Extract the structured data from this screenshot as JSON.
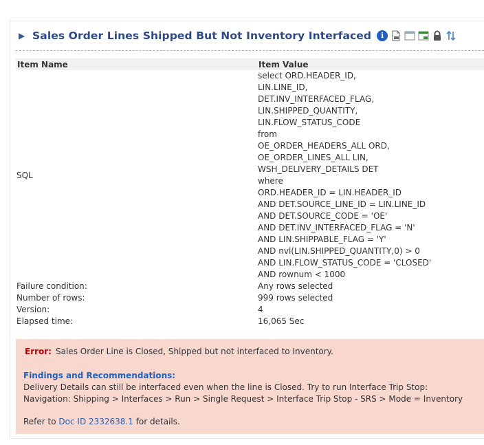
{
  "section": {
    "toggle": "▶",
    "title": "Sales Order Lines Shipped But Not Inventory Interfaced",
    "icons": [
      "info-icon",
      "sql-document-icon",
      "table-view-icon",
      "export-db-icon",
      "lock-icon",
      "sort-icon"
    ]
  },
  "table": {
    "headers": {
      "name": "Item Name",
      "value": "Item Value"
    },
    "sql_label": "SQL",
    "sql_lines": [
      "select ORD.HEADER_ID,",
      "LIN.LINE_ID,",
      "DET.INV_INTERFACED_FLAG,",
      "LIN.SHIPPED_QUANTITY,",
      "LIN.FLOW_STATUS_CODE",
      "from",
      "OE_ORDER_HEADERS_ALL ORD,",
      "OE_ORDER_LINES_ALL LIN,",
      "WSH_DELIVERY_DETAILS DET",
      "where",
      "ORD.HEADER_ID = LIN.HEADER_ID",
      "AND DET.SOURCE_LINE_ID = LIN.LINE_ID",
      "AND DET.SOURCE_CODE = 'OE'",
      "AND DET.INV_INTERFACED_FLAG = 'N'",
      "AND LIN.SHIPPABLE_FLAG = 'Y'",
      "AND nvl(LIN.SHIPPED_QUANTITY,0) > 0",
      "AND LIN.FLOW_STATUS_CODE = 'CLOSED'",
      "AND rownum < 1000"
    ],
    "rows": [
      {
        "name": "Failure condition:",
        "value": "Any rows selected"
      },
      {
        "name": "Number of rows:",
        "value": "999 rows selected"
      },
      {
        "name": "Version:",
        "value": "4"
      },
      {
        "name": "Elapsed time:",
        "value": "16,065 Sec"
      }
    ]
  },
  "error": {
    "label": "Error:",
    "message": "Sales Order Line is Closed, Shipped but not interfaced to Inventory.",
    "findings_title": "Findings and Recommendations:",
    "findings_line1": "Delivery Details can still be interfaced even when the line is Closed. Try to run Interface Trip Stop:",
    "findings_line2": "Navigation: Shipping > Interfaces > Run > Single Request > Interface Trip Stop - SRS > Mode = Inventory",
    "refer_prefix": "Refer to ",
    "doc_link": "Doc ID 2332638.1",
    "refer_suffix": " for details.",
    "bg_color": "#f8d7cf",
    "label_color": "#c00000"
  }
}
